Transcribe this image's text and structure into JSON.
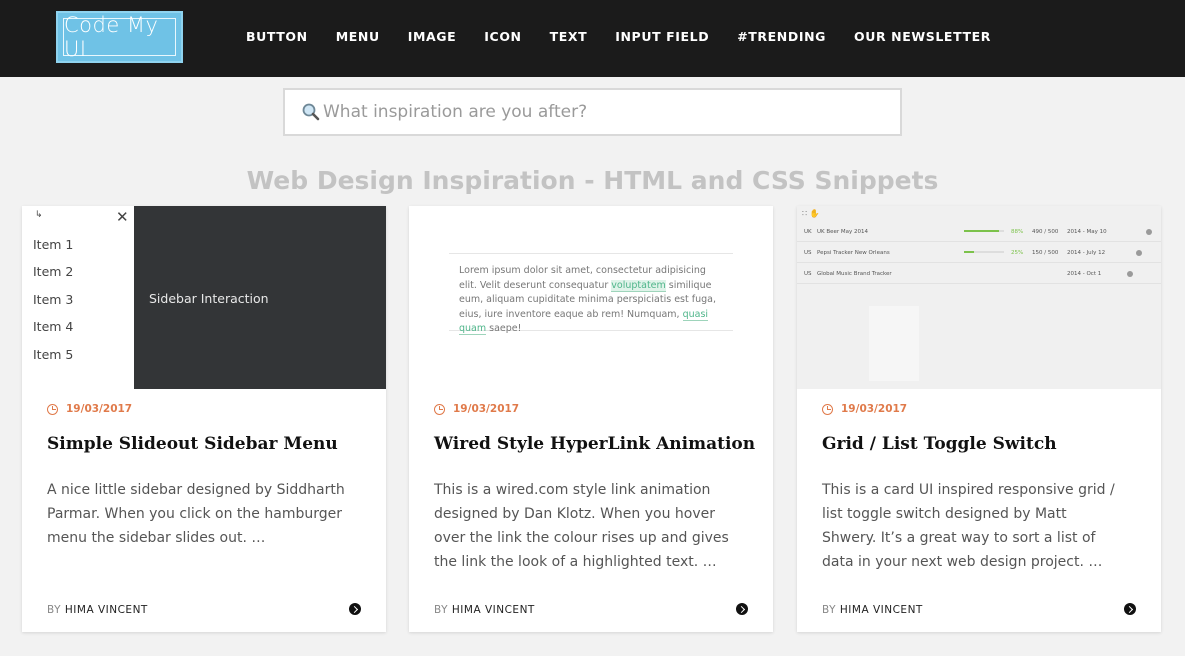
{
  "logo": {
    "text": "Code My UI"
  },
  "nav": {
    "items": [
      "BUTTON",
      "MENU",
      "IMAGE",
      "ICON",
      "TEXT",
      "INPUT FIELD",
      "#TRENDING",
      "OUR NEWSLETTER"
    ]
  },
  "search": {
    "placeholder": "What inspiration are you after?"
  },
  "page": {
    "heading": "Web Design Inspiration - HTML and CSS Snippets"
  },
  "colors": {
    "topbar": "#1b1b1b",
    "logo": "#6fc2e6",
    "accent": "#e07a4a"
  },
  "cards": [
    {
      "date": "19/03/2017",
      "title": "Simple Slideout Sidebar Menu",
      "description": "A nice little sidebar designed by Siddharth Parmar. When you click on the hamburger menu the sidebar slides out. …",
      "by": "BY",
      "author": "HIMA VINCENT",
      "thumb": {
        "items": [
          "Item 1",
          "Item 2",
          "Item 3",
          "Item 4",
          "Item 5"
        ],
        "panel_label": "Sidebar Interaction"
      }
    },
    {
      "date": "19/03/2017",
      "title": "Wired Style HyperLink Animation",
      "description": "This is a wired.com style link animation designed by Dan Klotz. When you hover over the link the colour rises up and gives the link the look of a highlighted text. …",
      "by": "BY",
      "author": "HIMA VINCENT",
      "thumb": {
        "text_a": "Lorem ipsum dolor sit amet, consectetur adipisicing elit. Velit deserunt consequatur ",
        "link_1": "voluptatem",
        "text_b": " similique eum, aliquam cupiditate minima perspiciatis est fuga, eius, iure inventore eaque ab rem! Numquam, ",
        "link_2": "quasi quam",
        "text_c": " saepe!"
      }
    },
    {
      "date": "19/03/2017",
      "title": "Grid / List Toggle Switch",
      "description": "This is a card UI inspired responsive grid / list toggle switch designed by Matt Shwery. It’s a great way to sort a list of data in your next web design project. …",
      "by": "BY",
      "author": "HIMA VINCENT",
      "thumb": {
        "rows": [
          {
            "code": "UK",
            "name": "UK Beer May 2014",
            "percent": "88%",
            "progress": 0.88,
            "count": "490 / 500",
            "date": "2014 - May 10"
          },
          {
            "code": "US",
            "name": "Pepsi Tracker New Orleans",
            "percent": "25%",
            "progress": 0.25,
            "count": "150 / 500",
            "date": "2014 - July 12"
          },
          {
            "code": "US",
            "name": "Global Music Brand Tracker",
            "percent": "",
            "progress": 0,
            "count": "",
            "date": "2014 - Oct 1"
          }
        ]
      }
    }
  ]
}
